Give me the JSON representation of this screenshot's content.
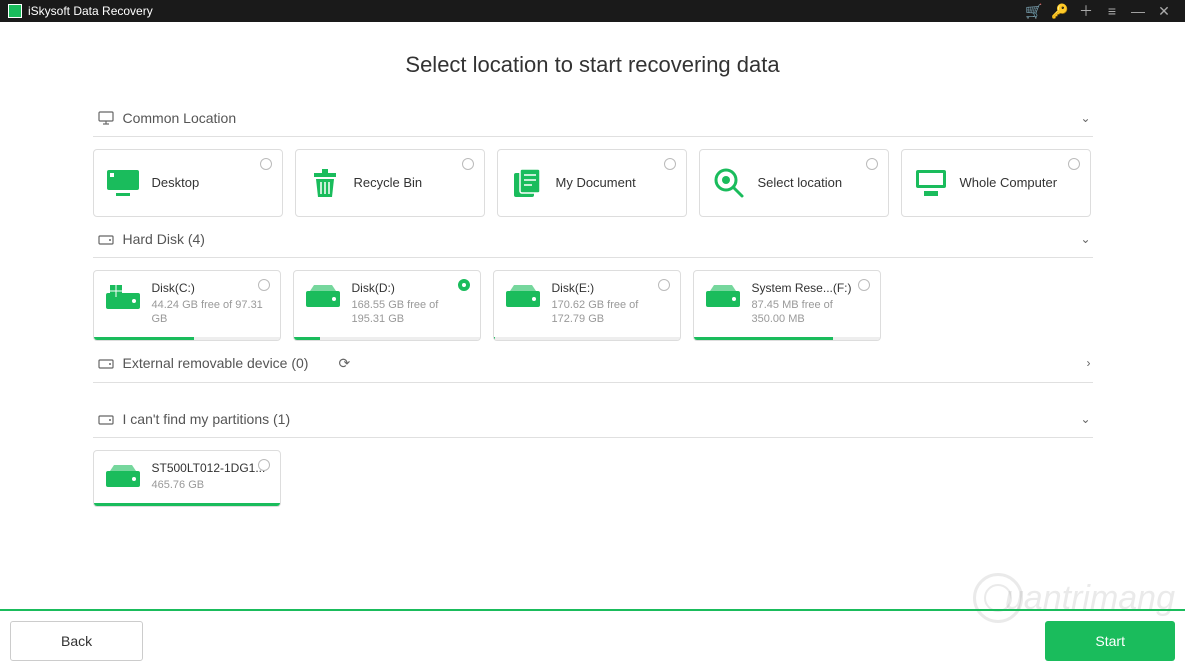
{
  "app_title": "iSkysoft Data Recovery",
  "page_title": "Select location to start recovering data",
  "sections": {
    "common": {
      "label": "Common Location",
      "items": [
        {
          "name": "Desktop"
        },
        {
          "name": "Recycle Bin"
        },
        {
          "name": "My Document"
        },
        {
          "name": "Select location"
        },
        {
          "name": "Whole Computer"
        }
      ]
    },
    "hard_disk": {
      "label": "Hard Disk (4)",
      "items": [
        {
          "name": "Disk(C:)",
          "free": "44.24 GB  free of 97.31 GB",
          "used_pct": 54,
          "selected": false
        },
        {
          "name": "Disk(D:)",
          "free": "168.55 GB  free of 195.31 GB",
          "used_pct": 14,
          "selected": true
        },
        {
          "name": "Disk(E:)",
          "free": "170.62 GB  free of 172.79 GB",
          "used_pct": 1,
          "selected": false
        },
        {
          "name": "System Rese...(F:)",
          "free": "87.45 MB  free of 350.00 MB",
          "used_pct": 75,
          "selected": false
        }
      ]
    },
    "external": {
      "label": "External removable device (0)"
    },
    "cant_find": {
      "label": "I can't find my partitions (1)",
      "items": [
        {
          "name": "ST500LT012-1DG1...",
          "free": "465.76 GB",
          "used_pct": 100
        }
      ]
    }
  },
  "footer": {
    "back": "Back",
    "start": "Start"
  },
  "watermark": "uantrimang"
}
